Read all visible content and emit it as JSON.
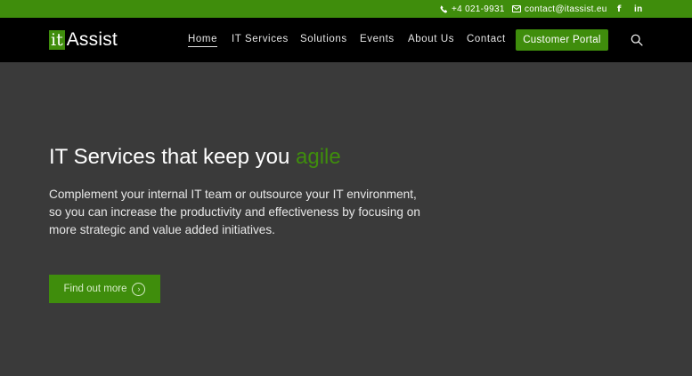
{
  "topbar": {
    "phone": "+4 021-9931",
    "email": "contact@itassist.eu",
    "facebook_icon_text": "f",
    "linkedin_icon_text": "in"
  },
  "logo": {
    "badge": "it",
    "rest": "Assist"
  },
  "nav": {
    "items": [
      {
        "label": "Home"
      },
      {
        "label": "IT Services"
      },
      {
        "label": "Solutions"
      },
      {
        "label": "Events"
      },
      {
        "label": "About Us"
      },
      {
        "label": "Contact"
      }
    ],
    "portal_label": "Customer Portal"
  },
  "hero": {
    "title_main": "IT Services that keep you ",
    "title_accent": "agile",
    "description": "Complement your internal IT team or outsource your IT environment, so you can increase the productivity and effectiveness by focusing on more strategic and value added initiatives.",
    "cta_label": "Find out more",
    "cta_icon_text": "›"
  },
  "colors": {
    "brand_green": "#3f8d0c",
    "header_bg": "#000000",
    "hero_bg": "#3a3a3a"
  },
  "icons": [
    "phone-icon",
    "envelope-icon",
    "facebook-icon",
    "linkedin-icon",
    "search-icon",
    "chevron-right-icon"
  ]
}
